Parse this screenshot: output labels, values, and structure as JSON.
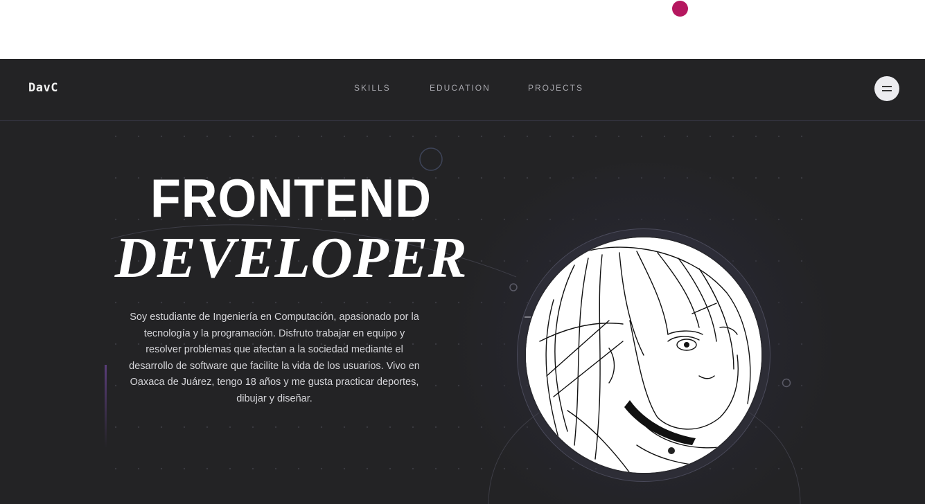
{
  "brand": {
    "logo_text": "DavC"
  },
  "nav": {
    "items": [
      {
        "label": "SKILLS"
      },
      {
        "label": "EDUCATION"
      },
      {
        "label": "PROJECTS"
      }
    ],
    "menu_icon": "hamburger-menu-icon"
  },
  "hero": {
    "title_line1": "FRONTEND",
    "title_line2": "DEVELOPER",
    "bio_lines": [
      "Soy estudiante de Ingeniería en Computación, apasionado por la",
      "tecnología y la programación. Disfruto trabajar en equipo y",
      "resolver problemas que afectan a la sociedad mediante el",
      "desarrollo de software que facilite la vida de los usuarios. Vivo en",
      "Oaxaca de Juárez, tengo 18 años y me gusta practicar deportes,",
      "dibujar y diseñar."
    ],
    "avatar": "anime-sketch-portrait"
  },
  "colors": {
    "background": "#232325",
    "accent_dot": "#b5175f",
    "text_primary": "#ffffff",
    "nav_text": "#a7a7ad"
  }
}
